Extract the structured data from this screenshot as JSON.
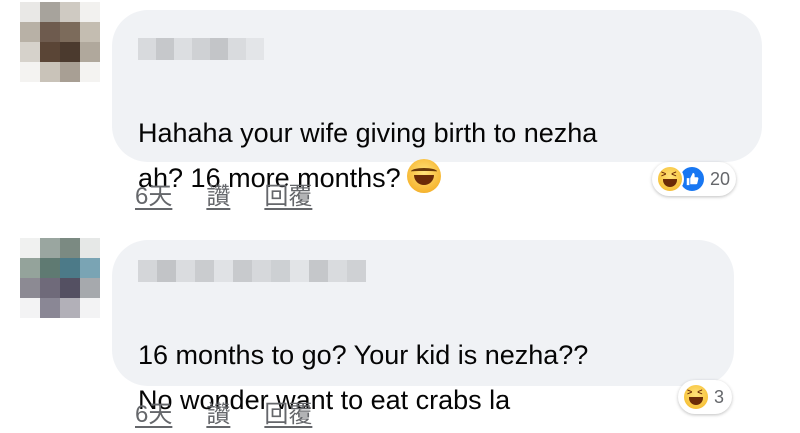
{
  "comments": [
    {
      "text": "Hahaha your wife giving birth to nezha\nah? 16 more months?",
      "reaction_count": "20",
      "reactions": [
        "haha-icon",
        "like-icon"
      ],
      "actions": {
        "time": "6天",
        "like": "讚",
        "reply": "回覆"
      }
    },
    {
      "text": "16 months to go? Your kid is nezha??\nNo wonder want to eat crabs la",
      "reaction_count": "3",
      "reactions": [
        "haha-icon"
      ],
      "actions": {
        "time": "6天",
        "like": "讚",
        "reply": "回覆"
      }
    }
  ],
  "colors": {
    "bubble": "#f0f2f5",
    "meta": "#65676b",
    "like_blue": "#1877f2"
  }
}
